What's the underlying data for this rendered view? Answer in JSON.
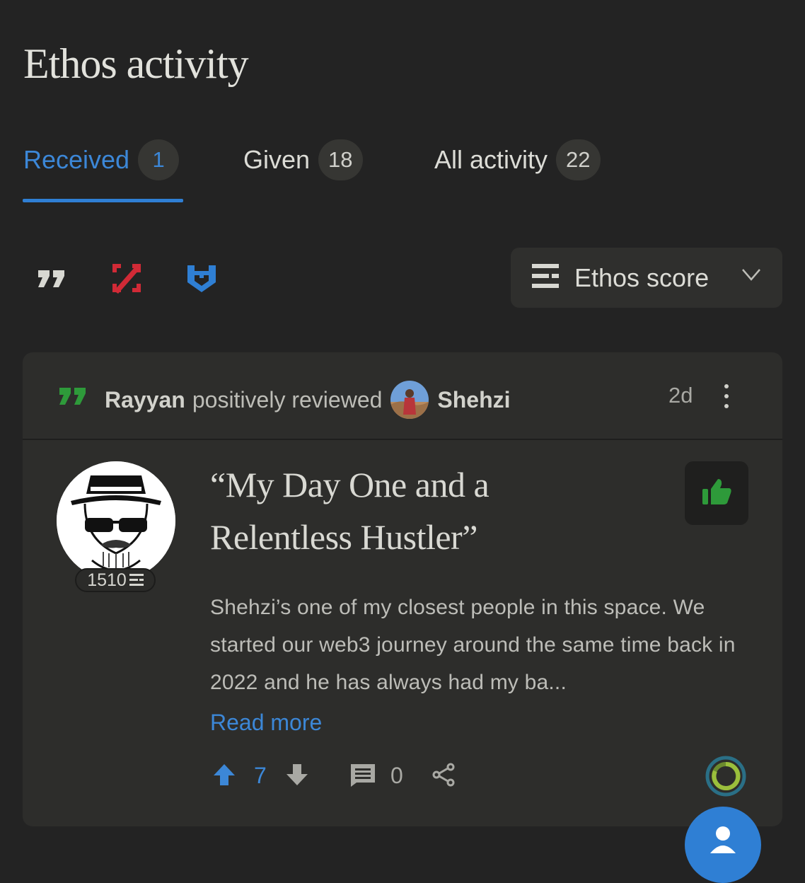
{
  "page": {
    "title": "Ethos activity"
  },
  "tabs": [
    {
      "label": "Received",
      "count": "1",
      "active": true
    },
    {
      "label": "Given",
      "count": "18",
      "active": false
    },
    {
      "label": "All activity",
      "count": "22",
      "active": false
    }
  ],
  "filters": {
    "icons": [
      "review-quote-icon",
      "slash-icon",
      "vouch-shield-icon"
    ],
    "sort": {
      "label": "Ethos score",
      "icon": "ethos-score-icon"
    }
  },
  "review": {
    "author": "Rayyan",
    "verb": "positively reviewed",
    "subject": "Shehzi",
    "time": "2d",
    "author_score": "1510",
    "title": "“My Day One and a Relentless Hustler”",
    "body": "Shehzi’s one of my closest people in this space. We started our web3 journey around the same time back in 2022 and he has always had my ba...",
    "read_more": "Read more",
    "upvotes": "7",
    "comments": "0",
    "sentiment": "positive"
  },
  "colors": {
    "background": "#232323",
    "card": "#2d2d2b",
    "accent_blue": "#3c87d7",
    "positive_green": "#2e9a3a",
    "slash_red": "#d12a36"
  }
}
